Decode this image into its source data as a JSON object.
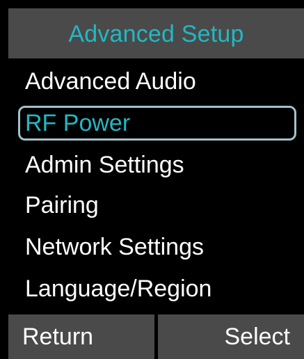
{
  "title_bar": {
    "title": "Advanced Setup"
  },
  "menu": {
    "items": [
      {
        "label": "Advanced Audio"
      },
      {
        "label": "RF Power"
      },
      {
        "label": "Admin Settings"
      },
      {
        "label": "Pairing"
      },
      {
        "label": "Network Settings"
      },
      {
        "label": "Language/Region"
      }
    ],
    "selected_label": "RF Power"
  },
  "softkeys": {
    "left_label": "Return",
    "right_label": "Select"
  },
  "colors": {
    "accent": "#22b8c3",
    "bar_background": "#4a4a4a",
    "screen_background": "#000000",
    "text": "#ffffff",
    "selection_border": "#9fc3c9"
  }
}
